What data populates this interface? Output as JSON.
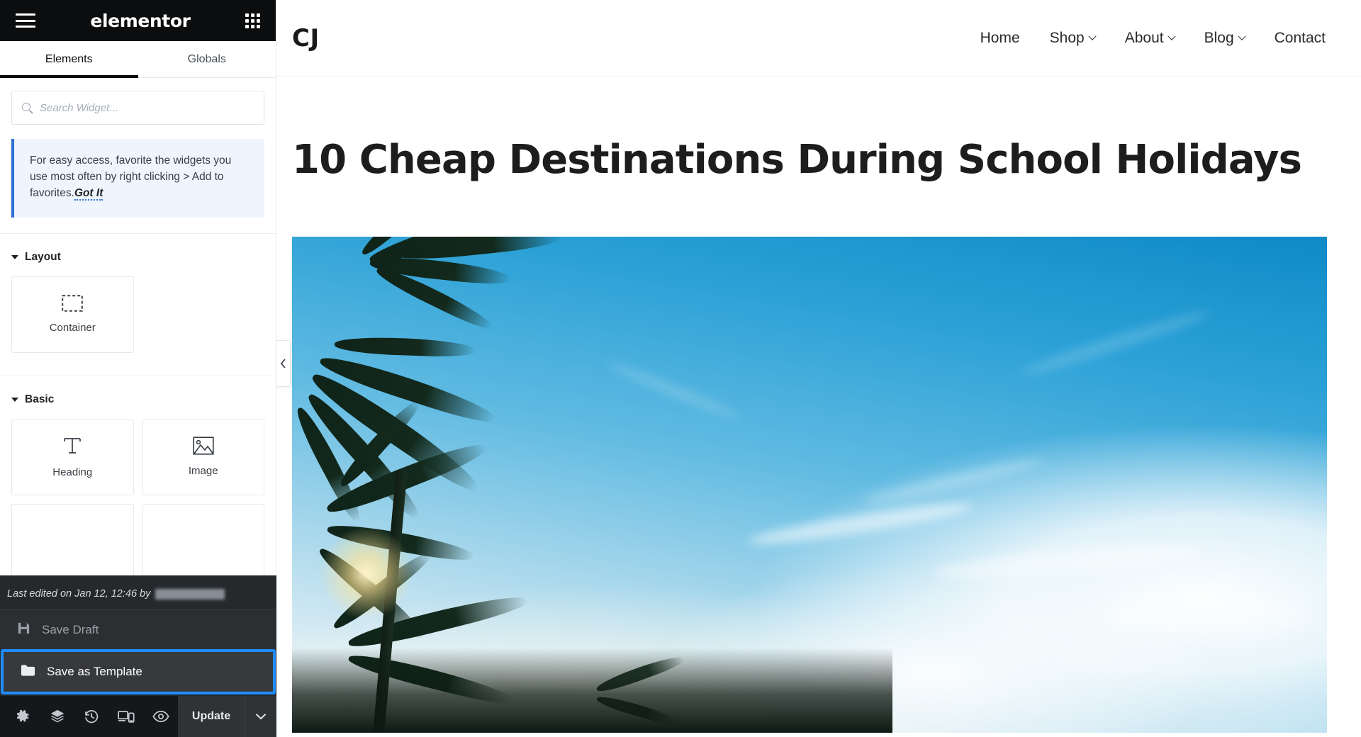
{
  "panel": {
    "header": {
      "menu_icon": "hamburger-icon",
      "brand": "elementor",
      "apps_icon": "grid-apps-icon"
    },
    "tabs": [
      {
        "label": "Elements",
        "active": true
      },
      {
        "label": "Globals",
        "active": false
      }
    ],
    "search": {
      "placeholder": "Search Widget...",
      "value": "",
      "icon": "search-icon"
    },
    "notice": {
      "text": "For easy access, favorite the widgets you use most often by right clicking > Add to favorites.",
      "cta": "Got It",
      "accent_color": "#2e6fd6",
      "background": "#eff5fd"
    },
    "sections": [
      {
        "title": "Layout",
        "expanded": true,
        "widgets": [
          {
            "label": "Container",
            "icon": "container-icon"
          }
        ]
      },
      {
        "title": "Basic",
        "expanded": true,
        "widgets": [
          {
            "label": "Heading",
            "icon": "heading-text-icon"
          },
          {
            "label": "Image",
            "icon": "image-picture-icon"
          }
        ]
      }
    ],
    "footer": {
      "last_edited_prefix": "Last edited on Jan 12, 12:46 by",
      "last_edited_author": "",
      "save_draft": {
        "label": "Save Draft",
        "icon": "floppy-disk-icon"
      },
      "save_template": {
        "label": "Save as Template",
        "icon": "folder-icon",
        "highlighted": true,
        "highlight_color": "#1e8cff"
      },
      "toolbar_icons": [
        {
          "name": "settings-gear-icon"
        },
        {
          "name": "navigator-layers-icon"
        },
        {
          "name": "history-clock-icon"
        },
        {
          "name": "responsive-device-icon"
        },
        {
          "name": "preview-eye-icon"
        }
      ],
      "update_label": "Update",
      "update_caret_icon": "chevron-down-icon"
    },
    "collapse_handle_icon": "chevron-left-icon"
  },
  "preview": {
    "site": {
      "logo": "CJ",
      "nav": [
        {
          "label": "Home",
          "has_dropdown": false
        },
        {
          "label": "Shop",
          "has_dropdown": true
        },
        {
          "label": "About",
          "has_dropdown": true
        },
        {
          "label": "Blog",
          "has_dropdown": true
        },
        {
          "label": "Contact",
          "has_dropdown": false
        }
      ]
    },
    "post": {
      "title": "10 Cheap Destinations During School Holidays",
      "featured_image_alt": "palm trees against blue sky with clouds"
    }
  }
}
